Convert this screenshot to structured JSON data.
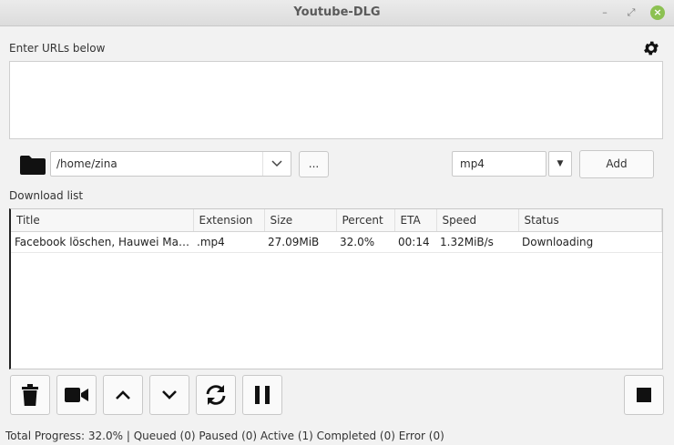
{
  "window": {
    "title": "Youtube-DLG"
  },
  "urls": {
    "label": "Enter URLs below",
    "value": ""
  },
  "path": {
    "value": "/home/zina",
    "browse_label": "..."
  },
  "format": {
    "value": "mp4",
    "add_label": "Add"
  },
  "download_list": {
    "label": "Download list",
    "columns": [
      "Title",
      "Extension",
      "Size",
      "Percent",
      "ETA",
      "Speed",
      "Status"
    ],
    "rows": [
      {
        "title": "Facebook löschen, Hauwei Mate ...",
        "extension": ".mp4",
        "size": "27.09MiB",
        "percent": "32.0%",
        "eta": "00:14",
        "speed": "1.32MiB/s",
        "status": "Downloading"
      }
    ]
  },
  "toolbar": {
    "icons": [
      "trash-icon",
      "video-camera-icon",
      "chevron-up-icon",
      "chevron-down-icon",
      "reload-icon",
      "pause-icon",
      "stop-icon"
    ]
  },
  "status_bar": {
    "text": "Total Progress: 32.0% | Queued (0) Paused (0) Active (1) Completed (0) Error (0)"
  }
}
